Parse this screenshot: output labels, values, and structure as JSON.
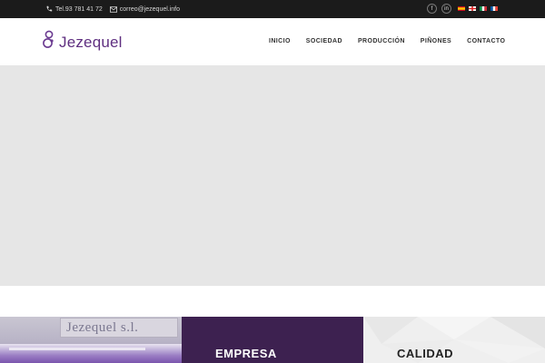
{
  "topbar": {
    "phone": "Tel.93 781 41 72",
    "email": "correo@jezequel.info",
    "social": [
      {
        "name": "facebook",
        "glyph": "f"
      },
      {
        "name": "linkedin",
        "glyph": "in"
      }
    ],
    "languages": [
      "es",
      "ca",
      "it",
      "fr"
    ]
  },
  "header": {
    "logo_text": "Jezequel",
    "nav": [
      "INICIO",
      "SOCIEDAD",
      "PRODUCCIÓN",
      "PIÑONES",
      "CONTACTO"
    ]
  },
  "panels": {
    "photo_sign": "Jezequel s.l.",
    "empresa_title": "EMPRESA",
    "calidad_title": "CALIDAD"
  },
  "colors": {
    "topbar_bg": "#1b1b1b",
    "brand_purple": "#5f2f80",
    "empresa_bg": "#3d2150",
    "hero_bg": "#e6e6e6"
  },
  "icons": [
    "phone-icon",
    "mail-icon",
    "facebook-icon",
    "linkedin-icon",
    "logo-icon"
  ]
}
